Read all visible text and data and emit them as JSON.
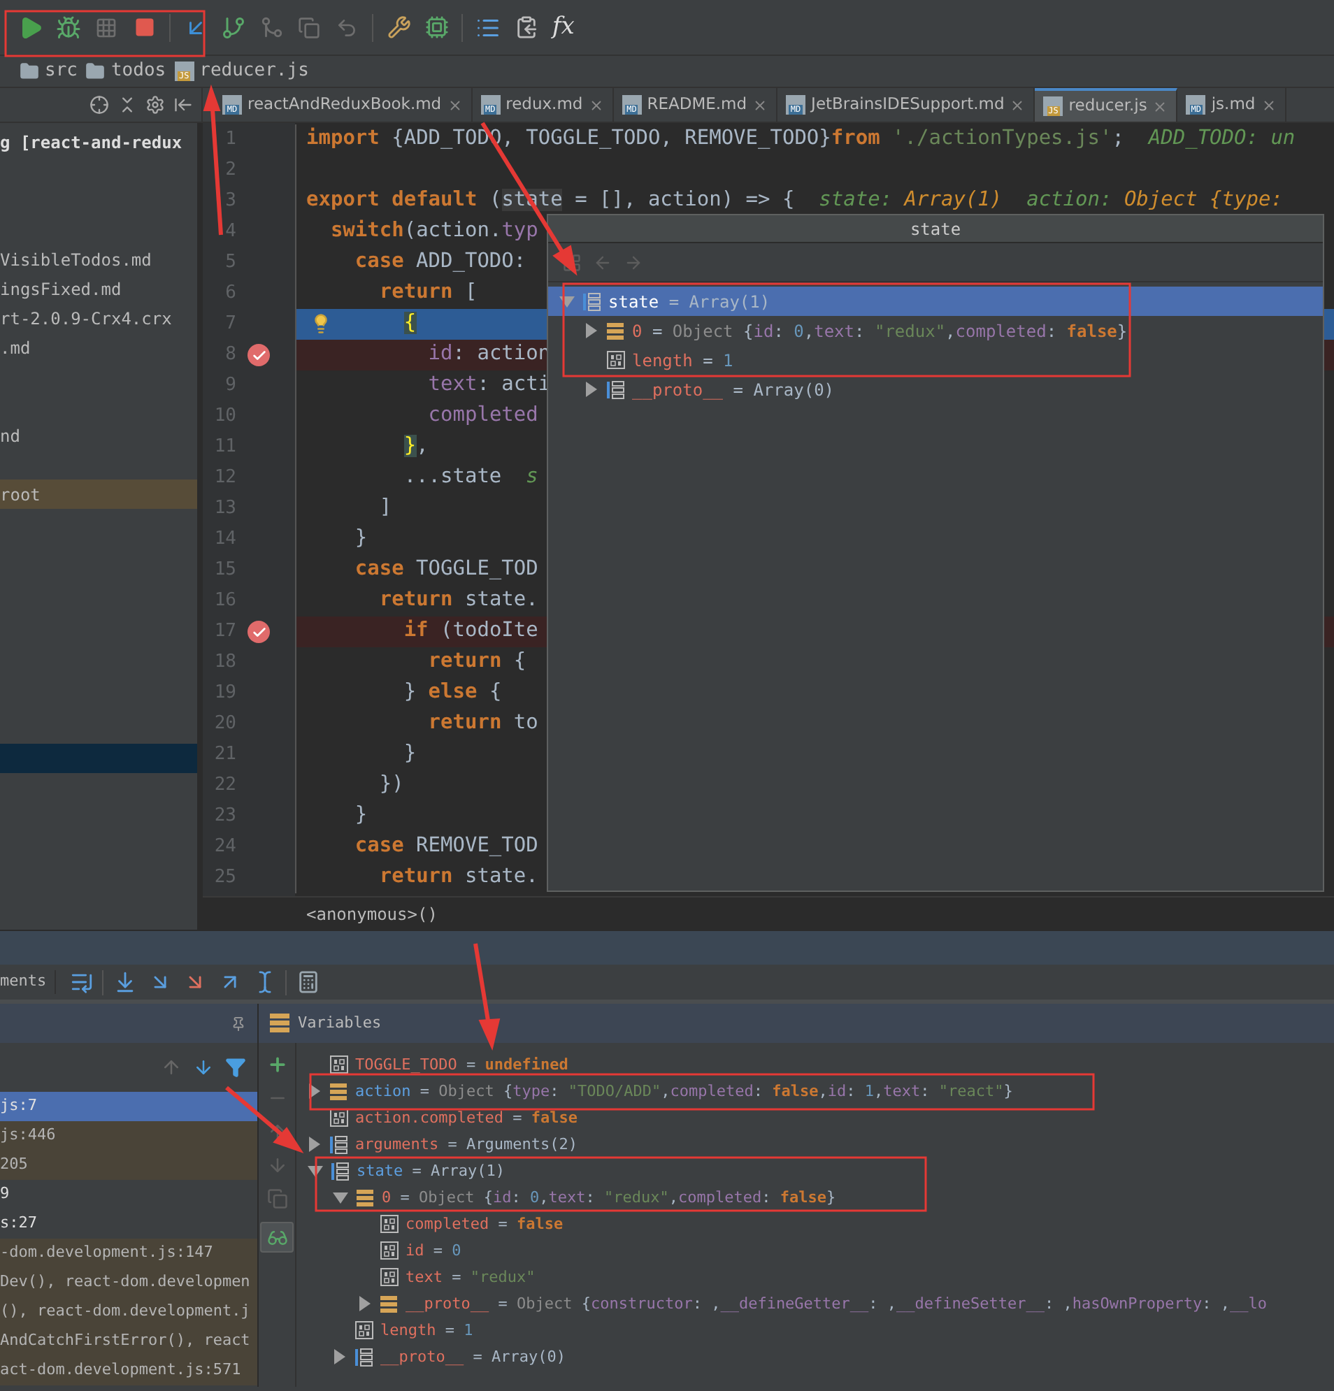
{
  "toolbar": {
    "formula_label": "fx"
  },
  "breadcrumb": [
    {
      "text": "src",
      "kind": "folder"
    },
    {
      "text": "todos",
      "kind": "folder"
    },
    {
      "text": "reducer.js",
      "kind": "file",
      "badge": "JS"
    }
  ],
  "tabs": [
    {
      "label": "reactAndReduxBook.md",
      "badge": "MD",
      "selected": false
    },
    {
      "label": "redux.md",
      "badge": "MD",
      "selected": false
    },
    {
      "label": "README.md",
      "badge": "MD",
      "selected": false
    },
    {
      "label": "JetBrainsIDESupport.md",
      "badge": "MD",
      "selected": false
    },
    {
      "label": "reducer.js",
      "badge": "JS",
      "selected": true
    },
    {
      "label": "js.md",
      "badge": "MD",
      "selected": false
    }
  ],
  "project": {
    "items": [
      {
        "text": "g [react-and-redux",
        "bold": true,
        "highlighted": false
      },
      {
        "text": "VisibleTodos.md",
        "bold": false,
        "highlighted": false
      },
      {
        "text": "ingsFixed.md",
        "bold": false,
        "highlighted": false
      },
      {
        "text": "rt-2.0.9-Crx4.crx",
        "bold": false,
        "highlighted": false
      },
      {
        "text": ".md",
        "bold": false,
        "highlighted": false
      },
      {
        "text": "nd",
        "bold": false,
        "highlighted": false
      },
      {
        "text": "root",
        "bold": false,
        "highlighted": true
      }
    ]
  },
  "editor": {
    "lines": [
      {
        "number": "1",
        "current": false,
        "breakpoint": false,
        "tokens": [
          {
            "kind": "kw",
            "text": "import"
          },
          {
            "kind": "plain",
            "text": " {ADD_TODO, TOGGLE_TODO, REMOVE_TODO}"
          },
          {
            "kind": "kw",
            "text": "from"
          },
          {
            "kind": "str",
            "text": " './actionTypes.js'"
          },
          {
            "kind": "plain",
            "text": ";  "
          },
          {
            "kind": "hint",
            "text": "ADD_TODO: un"
          }
        ]
      },
      {
        "number": "2",
        "current": false,
        "breakpoint": false
      },
      {
        "number": "3",
        "current": false,
        "breakpoint": false,
        "tokens": [
          {
            "kind": "kw",
            "text": "export default"
          },
          {
            "kind": "plain",
            "text": " ("
          },
          {
            "kind": "usage",
            "text": "state"
          },
          {
            "kind": "plain",
            "text": " = [], action) => {  "
          },
          {
            "kind": "hint",
            "text": "state: "
          },
          {
            "kind": "hintval",
            "text": "Array(1)"
          },
          {
            "kind": "hint",
            "text": "  action: "
          },
          {
            "kind": "hintval",
            "text": "Object {type:"
          }
        ]
      },
      {
        "number": "4",
        "current": false,
        "breakpoint": false,
        "tokens": [
          {
            "kind": "kw",
            "text": "switch"
          },
          {
            "kind": "plain",
            "text": "(action."
          },
          {
            "kind": "prop",
            "text": "typ"
          }
        ]
      },
      {
        "number": "5",
        "current": false,
        "breakpoint": false,
        "tokens": [
          {
            "kind": "kw",
            "text": "case"
          },
          {
            "kind": "plain",
            "text": " ADD_TODO:"
          }
        ]
      },
      {
        "number": "6",
        "current": false,
        "breakpoint": false,
        "tokens": [
          {
            "kind": "kw",
            "text": "return"
          },
          {
            "kind": "plain",
            "text": " ["
          }
        ]
      },
      {
        "number": "7",
        "current": true,
        "breakpoint": false,
        "tokens": [
          {
            "kind": "brace",
            "text": "{"
          }
        ]
      },
      {
        "number": "8",
        "current": false,
        "breakpoint": true,
        "tokens": [
          {
            "kind": "prop",
            "text": "id"
          },
          {
            "kind": "plain",
            "text": ": action"
          }
        ]
      },
      {
        "number": "9",
        "current": false,
        "breakpoint": false,
        "tokens": [
          {
            "kind": "prop",
            "text": "text"
          },
          {
            "kind": "plain",
            "text": ": acti"
          }
        ]
      },
      {
        "number": "10",
        "current": false,
        "breakpoint": false,
        "tokens": [
          {
            "kind": "prop",
            "text": "completed"
          }
        ]
      },
      {
        "number": "11",
        "current": false,
        "breakpoint": false,
        "tokens": [
          {
            "kind": "brace",
            "text": "}"
          },
          {
            "kind": "plain",
            "text": ","
          }
        ]
      },
      {
        "number": "12",
        "current": false,
        "breakpoint": false,
        "tokens": [
          {
            "kind": "plain",
            "text": "...state  "
          },
          {
            "kind": "hint",
            "text": "s"
          }
        ]
      },
      {
        "number": "13",
        "current": false,
        "breakpoint": false,
        "tokens": [
          {
            "kind": "plain",
            "text": "]"
          }
        ]
      },
      {
        "number": "14",
        "current": false,
        "breakpoint": false,
        "tokens": [
          {
            "kind": "plain",
            "text": "}"
          }
        ]
      },
      {
        "number": "15",
        "current": false,
        "breakpoint": false,
        "tokens": [
          {
            "kind": "kw",
            "text": "case"
          },
          {
            "kind": "plain",
            "text": " TOGGLE_TOD"
          }
        ]
      },
      {
        "number": "16",
        "current": false,
        "breakpoint": false,
        "tokens": [
          {
            "kind": "kw",
            "text": "return"
          },
          {
            "kind": "plain",
            "text": " state."
          }
        ]
      },
      {
        "number": "17",
        "current": false,
        "breakpoint": true,
        "tokens": [
          {
            "kind": "kw",
            "text": "if"
          },
          {
            "kind": "plain",
            "text": " (todoIte"
          }
        ]
      },
      {
        "number": "18",
        "current": false,
        "breakpoint": false,
        "tokens": [
          {
            "kind": "kw",
            "text": "return"
          },
          {
            "kind": "plain",
            "text": " {"
          }
        ]
      },
      {
        "number": "19",
        "current": false,
        "breakpoint": false,
        "tokens": [
          {
            "kind": "plain",
            "text": "} "
          },
          {
            "kind": "kw",
            "text": "else"
          },
          {
            "kind": "plain",
            "text": " {"
          }
        ]
      },
      {
        "number": "20",
        "current": false,
        "breakpoint": false,
        "tokens": [
          {
            "kind": "kw",
            "text": "return"
          },
          {
            "kind": "plain",
            "text": " to"
          }
        ]
      },
      {
        "number": "21",
        "current": false,
        "breakpoint": false,
        "tokens": [
          {
            "kind": "plain",
            "text": "}"
          }
        ]
      },
      {
        "number": "22",
        "current": false,
        "breakpoint": false,
        "tokens": [
          {
            "kind": "plain",
            "text": "})"
          }
        ]
      },
      {
        "number": "23",
        "current": false,
        "breakpoint": false,
        "tokens": [
          {
            "kind": "plain",
            "text": "}"
          }
        ]
      },
      {
        "number": "24",
        "current": false,
        "breakpoint": false,
        "tokens": [
          {
            "kind": "kw",
            "text": "case"
          },
          {
            "kind": "plain",
            "text": " REMOVE_TOD"
          }
        ]
      },
      {
        "number": "25",
        "current": false,
        "breakpoint": false,
        "tokens": [
          {
            "kind": "kw",
            "text": "return"
          },
          {
            "kind": "plain",
            "text": " state."
          }
        ]
      }
    ],
    "breadcrumb": "<anonymous>()"
  },
  "popup": {
    "title": "state",
    "tree": [
      {
        "name": "state",
        "local": true,
        "kind": "array",
        "expanded": true,
        "selected": true,
        "value": [
          {
            "kind": "plain",
            "text": "= Array(1)"
          }
        ],
        "children": [
          {
            "name": "0",
            "local": false,
            "kind": "object",
            "expanded": false,
            "selected": false,
            "value": [
              {
                "kind": "plain",
                "text": "= "
              },
              {
                "kind": "type",
                "text": "Object "
              },
              {
                "kind": "plain",
                "text": "{"
              },
              {
                "kind": "key",
                "text": "id"
              },
              {
                "kind": "plain",
                "text": ": "
              },
              {
                "kind": "num",
                "text": "0"
              },
              {
                "kind": "plain",
                "text": ","
              },
              {
                "kind": "key",
                "text": "text"
              },
              {
                "kind": "plain",
                "text": ": "
              },
              {
                "kind": "str",
                "text": "\"redux\""
              },
              {
                "kind": "plain",
                "text": ","
              },
              {
                "kind": "key",
                "text": "completed"
              },
              {
                "kind": "plain",
                "text": ": "
              },
              {
                "kind": "bool",
                "text": "false"
              },
              {
                "kind": "plain",
                "text": "}"
              }
            ]
          },
          {
            "name": "length",
            "local": false,
            "kind": "primitive",
            "selected": false,
            "value": [
              {
                "kind": "plain",
                "text": "= "
              },
              {
                "kind": "num",
                "text": "1"
              }
            ]
          },
          {
            "name": "__proto__",
            "local": false,
            "kind": "array",
            "expanded": false,
            "selected": false,
            "value": [
              {
                "kind": "plain",
                "text": "= Array(0)"
              }
            ]
          }
        ]
      }
    ]
  },
  "debugger": {
    "tab_label": "ments",
    "frames": [
      {
        "text": "js:7",
        "selected": true,
        "kind": "app"
      },
      {
        "text": "js:446",
        "selected": false,
        "kind": "library"
      },
      {
        "text": "205",
        "selected": false,
        "kind": "library"
      },
      {
        "text": "9",
        "selected": false,
        "kind": "app"
      },
      {
        "text": "s:27",
        "selected": false,
        "kind": "app"
      },
      {
        "text": "-dom.development.js:147",
        "selected": false,
        "kind": "library"
      },
      {
        "text": "Dev(), react-dom.developmen",
        "selected": false,
        "kind": "library"
      },
      {
        "text": "(), react-dom.development.j",
        "selected": false,
        "kind": "library"
      },
      {
        "text": "AndCatchFirstError(), react",
        "selected": false,
        "kind": "library"
      },
      {
        "text": "act-dom.development.js:571",
        "selected": false,
        "kind": "library"
      }
    ],
    "variables_title": "Variables",
    "variables": [
      {
        "name": "TOGGLE_TODO",
        "local": false,
        "kind": "primitive",
        "selected": false,
        "value": [
          {
            "kind": "plain",
            "text": "= "
          },
          {
            "kind": "bool",
            "text": "undefined"
          }
        ]
      },
      {
        "name": "action",
        "local": true,
        "kind": "object",
        "expanded": false,
        "selected": false,
        "value": [
          {
            "kind": "plain",
            "text": "= "
          },
          {
            "kind": "type",
            "text": "Object "
          },
          {
            "kind": "plain",
            "text": "{"
          },
          {
            "kind": "key",
            "text": "type"
          },
          {
            "kind": "plain",
            "text": ": "
          },
          {
            "kind": "str",
            "text": "\"TODO/ADD\""
          },
          {
            "kind": "plain",
            "text": ","
          },
          {
            "kind": "key",
            "text": "completed"
          },
          {
            "kind": "plain",
            "text": ": "
          },
          {
            "kind": "bool",
            "text": "false"
          },
          {
            "kind": "plain",
            "text": ","
          },
          {
            "kind": "key",
            "text": "id"
          },
          {
            "kind": "plain",
            "text": ": "
          },
          {
            "kind": "num",
            "text": "1"
          },
          {
            "kind": "plain",
            "text": ","
          },
          {
            "kind": "key",
            "text": "text"
          },
          {
            "kind": "plain",
            "text": ": "
          },
          {
            "kind": "str",
            "text": "\"react\""
          },
          {
            "kind": "plain",
            "text": "}"
          }
        ]
      },
      {
        "name": "action.completed",
        "local": false,
        "kind": "primitive",
        "selected": false,
        "value": [
          {
            "kind": "plain",
            "text": "= "
          },
          {
            "kind": "bool",
            "text": "false"
          }
        ]
      },
      {
        "name": "arguments",
        "local": false,
        "kind": "array",
        "expanded": false,
        "selected": false,
        "value": [
          {
            "kind": "plain",
            "text": "= Arguments(2)"
          }
        ]
      },
      {
        "name": "state",
        "local": true,
        "kind": "array",
        "expanded": true,
        "selected": false,
        "value": [
          {
            "kind": "plain",
            "text": "= Array(1)"
          }
        ],
        "children": [
          {
            "name": "0",
            "local": false,
            "kind": "object",
            "expanded": true,
            "selected": false,
            "value": [
              {
                "kind": "plain",
                "text": "= "
              },
              {
                "kind": "type",
                "text": "Object "
              },
              {
                "kind": "plain",
                "text": "{"
              },
              {
                "kind": "key",
                "text": "id"
              },
              {
                "kind": "plain",
                "text": ": "
              },
              {
                "kind": "num",
                "text": "0"
              },
              {
                "kind": "plain",
                "text": ","
              },
              {
                "kind": "key",
                "text": "text"
              },
              {
                "kind": "plain",
                "text": ": "
              },
              {
                "kind": "str",
                "text": "\"redux\""
              },
              {
                "kind": "plain",
                "text": ","
              },
              {
                "kind": "key",
                "text": "completed"
              },
              {
                "kind": "plain",
                "text": ": "
              },
              {
                "kind": "bool",
                "text": "false"
              },
              {
                "kind": "plain",
                "text": "}"
              }
            ],
            "children": [
              {
                "name": "completed",
                "local": false,
                "kind": "primitive",
                "selected": false,
                "value": [
                  {
                    "kind": "plain",
                    "text": "= "
                  },
                  {
                    "kind": "bool",
                    "text": "false"
                  }
                ]
              },
              {
                "name": "id",
                "local": false,
                "kind": "primitive",
                "selected": false,
                "value": [
                  {
                    "kind": "plain",
                    "text": "= "
                  },
                  {
                    "kind": "num",
                    "text": "0"
                  }
                ]
              },
              {
                "name": "text",
                "local": false,
                "kind": "primitive",
                "selected": false,
                "value": [
                  {
                    "kind": "plain",
                    "text": "= "
                  },
                  {
                    "kind": "str",
                    "text": "\"redux\""
                  }
                ]
              },
              {
                "name": "__proto__",
                "local": false,
                "kind": "object",
                "expanded": false,
                "selected": false,
                "value": [
                  {
                    "kind": "plain",
                    "text": "= "
                  },
                  {
                    "kind": "type",
                    "text": "Object "
                  },
                  {
                    "kind": "plain",
                    "text": "{"
                  },
                  {
                    "kind": "key",
                    "text": "constructor"
                  },
                  {
                    "kind": "plain",
                    "text": ": ,"
                  },
                  {
                    "kind": "key",
                    "text": "__defineGetter__"
                  },
                  {
                    "kind": "plain",
                    "text": ": ,"
                  },
                  {
                    "kind": "key",
                    "text": "__defineSetter__"
                  },
                  {
                    "kind": "plain",
                    "text": ": ,"
                  },
                  {
                    "kind": "key",
                    "text": "hasOwnProperty"
                  },
                  {
                    "kind": "plain",
                    "text": ": ,"
                  },
                  {
                    "kind": "key",
                    "text": "__lo"
                  }
                ]
              }
            ]
          },
          {
            "name": "length",
            "local": false,
            "kind": "primitive",
            "selected": false,
            "value": [
              {
                "kind": "plain",
                "text": "= "
              },
              {
                "kind": "num",
                "text": "1"
              }
            ]
          },
          {
            "name": "__proto__",
            "local": false,
            "kind": "array",
            "expanded": false,
            "selected": false,
            "value": [
              {
                "kind": "plain",
                "text": "= Array(0)"
              }
            ]
          }
        ]
      }
    ]
  }
}
